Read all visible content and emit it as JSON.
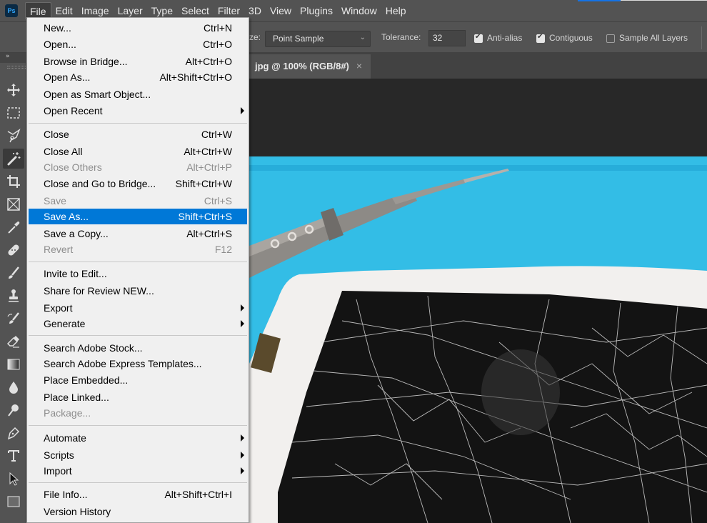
{
  "app": {
    "logo": "Ps",
    "menubar": [
      "File",
      "Edit",
      "Image",
      "Layer",
      "Type",
      "Select",
      "Filter",
      "3D",
      "View",
      "Plugins",
      "Window",
      "Help"
    ],
    "active_menu": "File"
  },
  "options": {
    "sample_size_label": "ze:",
    "sample_size_value": "Point Sample",
    "tolerance_label": "Tolerance:",
    "tolerance_value": "32",
    "anti_alias_label": "Anti-alias",
    "anti_alias_checked": true,
    "contiguous_label": "Contiguous",
    "contiguous_checked": true,
    "sample_all_layers_label": "Sample All Layers",
    "sample_all_layers_checked": false
  },
  "toolbar": {
    "collapse_label": "»",
    "tools": [
      {
        "name": "move-tool-icon"
      },
      {
        "name": "rectangular-marquee-tool-icon"
      },
      {
        "name": "lasso-tool-icon"
      },
      {
        "name": "magic-wand-tool-icon",
        "selected": true
      },
      {
        "name": "crop-tool-icon"
      },
      {
        "name": "frame-tool-icon"
      },
      {
        "name": "eyedropper-tool-icon"
      },
      {
        "name": "healing-brush-tool-icon"
      },
      {
        "name": "brush-tool-icon"
      },
      {
        "name": "clone-stamp-tool-icon"
      },
      {
        "name": "history-brush-tool-icon"
      },
      {
        "name": "eraser-tool-icon"
      },
      {
        "name": "gradient-tool-icon"
      },
      {
        "name": "blur-tool-icon"
      },
      {
        "name": "dodge-tool-icon"
      },
      {
        "name": "pen-tool-icon"
      },
      {
        "name": "type-tool-icon"
      },
      {
        "name": "path-selection-tool-icon"
      },
      {
        "name": "rectangle-tool-icon"
      }
    ]
  },
  "document": {
    "tab_title": "jpg @ 100% (RGB/8#)",
    "close_glyph": "×",
    "image_description": "Cracked smartphone screen on blue mat with precision screwdriver"
  },
  "file_menu": {
    "groups": [
      [
        {
          "label": "New...",
          "shortcut": "Ctrl+N"
        },
        {
          "label": "Open...",
          "shortcut": "Ctrl+O"
        },
        {
          "label": "Browse in Bridge...",
          "shortcut": "Alt+Ctrl+O"
        },
        {
          "label": "Open As...",
          "shortcut": "Alt+Shift+Ctrl+O"
        },
        {
          "label": "Open as Smart Object...",
          "shortcut": ""
        },
        {
          "label": "Open Recent",
          "shortcut": "",
          "submenu": true
        }
      ],
      [
        {
          "label": "Close",
          "shortcut": "Ctrl+W"
        },
        {
          "label": "Close All",
          "shortcut": "Alt+Ctrl+W"
        },
        {
          "label": "Close Others",
          "shortcut": "Alt+Ctrl+P",
          "disabled": true
        },
        {
          "label": "Close and Go to Bridge...",
          "shortcut": "Shift+Ctrl+W"
        },
        {
          "label": "Save",
          "shortcut": "Ctrl+S",
          "disabled": true
        },
        {
          "label": "Save As...",
          "shortcut": "Shift+Ctrl+S",
          "highlighted": true
        },
        {
          "label": "Save a Copy...",
          "shortcut": "Alt+Ctrl+S"
        },
        {
          "label": "Revert",
          "shortcut": "F12",
          "disabled": true
        }
      ],
      [
        {
          "label": "Invite to Edit...",
          "shortcut": ""
        },
        {
          "label": "Share for Review NEW...",
          "shortcut": ""
        },
        {
          "label": "Export",
          "shortcut": "",
          "submenu": true
        },
        {
          "label": "Generate",
          "shortcut": "",
          "submenu": true
        }
      ],
      [
        {
          "label": "Search Adobe Stock...",
          "shortcut": ""
        },
        {
          "label": "Search Adobe Express Templates...",
          "shortcut": ""
        },
        {
          "label": "Place Embedded...",
          "shortcut": ""
        },
        {
          "label": "Place Linked...",
          "shortcut": ""
        },
        {
          "label": "Package...",
          "shortcut": "",
          "disabled": true
        }
      ],
      [
        {
          "label": "Automate",
          "shortcut": "",
          "submenu": true
        },
        {
          "label": "Scripts",
          "shortcut": "",
          "submenu": true
        },
        {
          "label": "Import",
          "shortcut": "",
          "submenu": true
        }
      ],
      [
        {
          "label": "File Info...",
          "shortcut": "Alt+Shift+Ctrl+I"
        },
        {
          "label": "Version History",
          "shortcut": ""
        }
      ]
    ]
  },
  "colors": {
    "highlight": "#0078d7",
    "menu_bg": "#f0f0f0",
    "app_bg": "#535353",
    "canvas_bg": "#282828",
    "mat_blue": "#33bde6"
  }
}
